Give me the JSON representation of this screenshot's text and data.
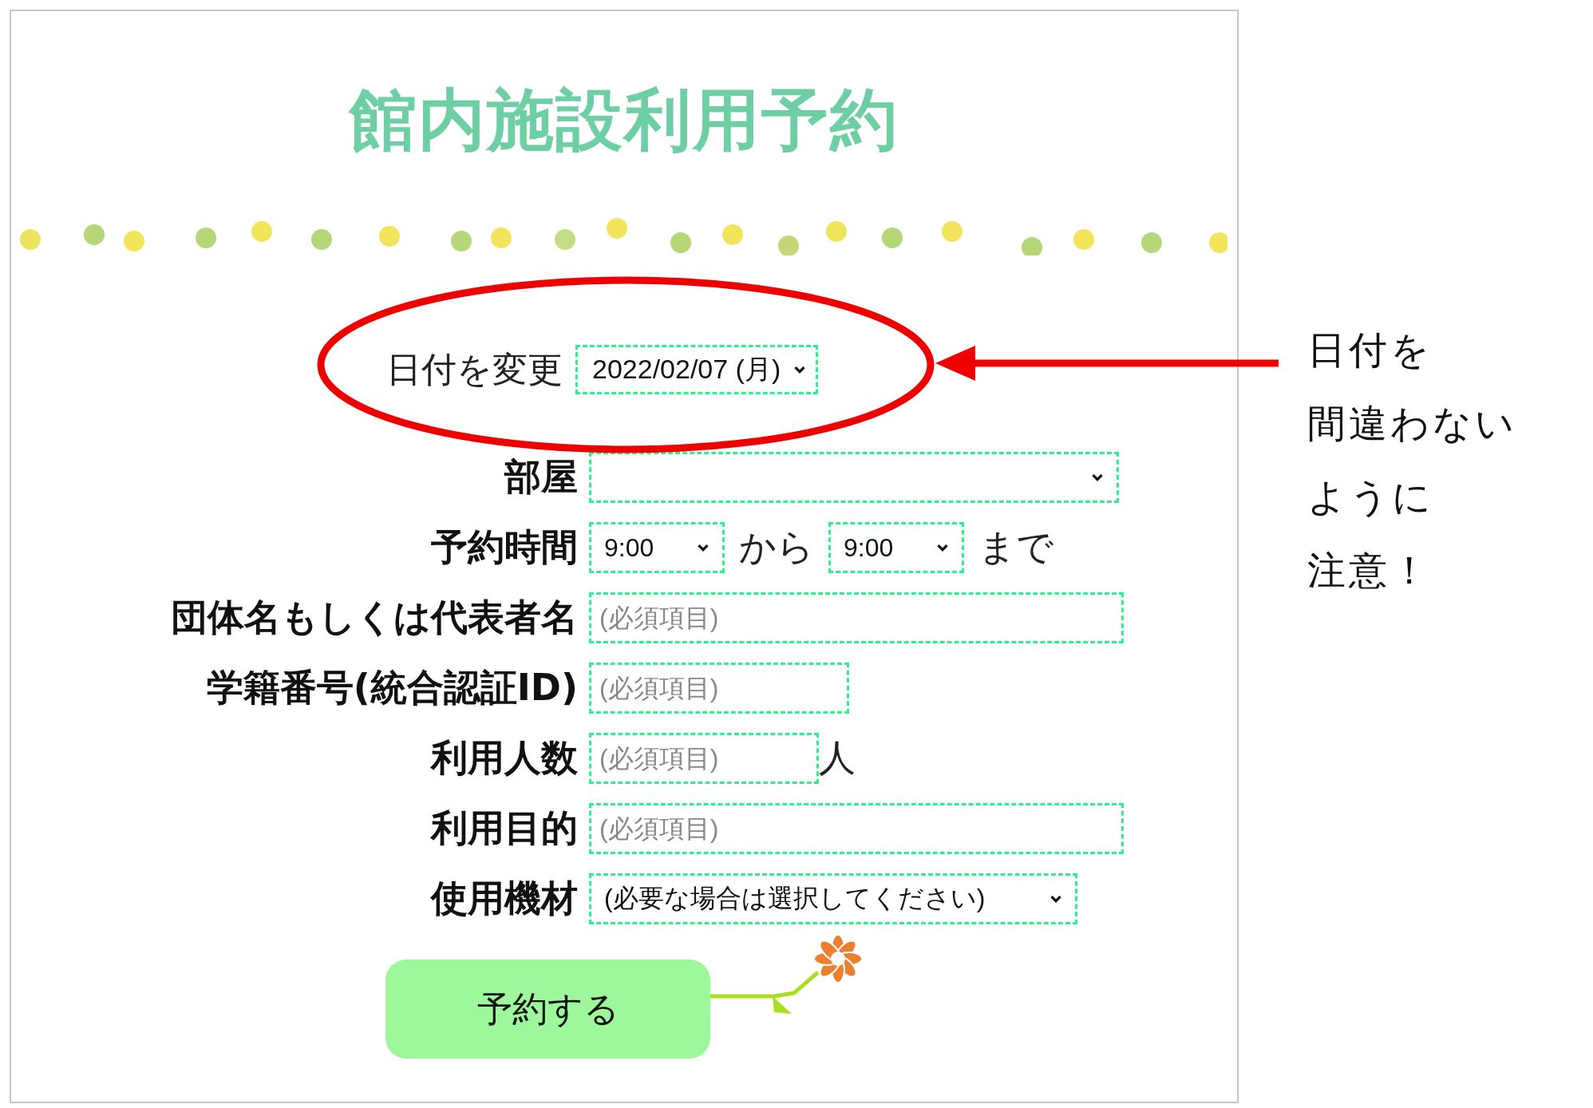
{
  "page": {
    "title": "館内施設利用予約"
  },
  "date": {
    "label": "日付を変更",
    "value": "2022/02/07 (月)"
  },
  "fields": [
    {
      "kind": "select",
      "label": "部屋"
    },
    {
      "kind": "time",
      "label": "予約時間",
      "from": "9:00",
      "from_suffix": "から",
      "to": "9:00",
      "to_suffix": "まで"
    },
    {
      "kind": "text",
      "label": "団体名もしくは代表者名",
      "placeholder": "(必須項目)"
    },
    {
      "kind": "text",
      "label": "学籍番号(統合認証ID)",
      "placeholder": "(必須項目)"
    },
    {
      "kind": "text",
      "label": "利用人数",
      "placeholder": "(必須項目)",
      "unit": "人"
    },
    {
      "kind": "text",
      "label": "利用目的",
      "placeholder": "(必須項目)"
    },
    {
      "kind": "select",
      "label": "使用機材",
      "value": "(必要な場合は選択してください)"
    }
  ],
  "submit_button": "予約する",
  "note": {
    "lines": [
      "日付を",
      "間違わない",
      "ように",
      "注意！"
    ]
  }
}
